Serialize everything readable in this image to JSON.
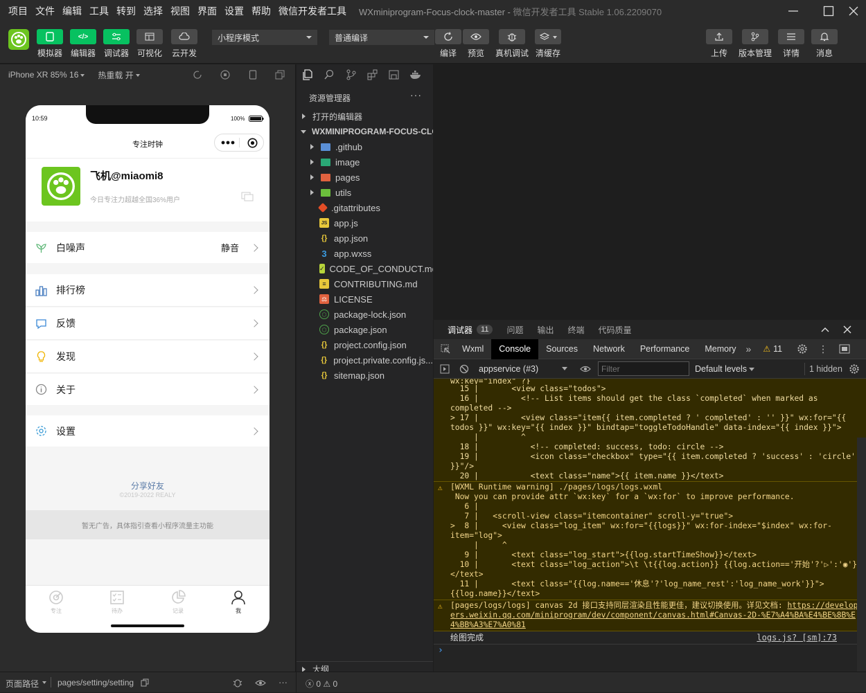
{
  "menu": {
    "items": [
      "项目",
      "文件",
      "编辑",
      "工具",
      "转到",
      "选择",
      "视图",
      "界面",
      "设置",
      "帮助",
      "微信开发者工具"
    ],
    "project_title": "WXminiprogram-Focus-clock-master",
    "app_version": "微信开发者工具 Stable 1.06.2209070"
  },
  "toolbar": {
    "simulator": "模拟器",
    "editor": "编辑器",
    "debugger": "调试器",
    "visual": "可视化",
    "cloud": "云开发",
    "mode_select": "小程序模式",
    "compile_select": "普通编译",
    "compile": "编译",
    "preview": "预览",
    "real_debug": "真机调试",
    "clear_cache": "清缓存",
    "upload": "上传",
    "version": "版本管理",
    "details": "详情",
    "messages": "消息",
    "accent": "#07c160"
  },
  "simulator": {
    "device": "iPhone XR 85% 16",
    "hot_reload": "热重载 开",
    "status_time": "10:59",
    "battery": "100%",
    "nav_title": "专注时钟",
    "user_name": "飞机@miaomi8",
    "user_sub": "今日专注力超越全国36%用户",
    "menu_items": [
      {
        "label": "白噪声",
        "value": "静音"
      },
      {
        "label": "排行榜",
        "value": ""
      },
      {
        "label": "反馈",
        "value": ""
      },
      {
        "label": "发现",
        "value": ""
      },
      {
        "label": "关于",
        "value": ""
      },
      {
        "label": "设置",
        "value": ""
      }
    ],
    "share": "分享好友",
    "copyright": "©2019-2022 REALY",
    "ad_text": "暂无广告，具体指引查看小程序流量主功能",
    "tabbar": [
      "专注",
      "待办",
      "记录",
      "我"
    ]
  },
  "explorer": {
    "title": "资源管理器",
    "open_editors": "打开的编辑器",
    "project_root": "WXMINIPROGRAM-FOCUS-CLO...",
    "folders": [
      ".github",
      "image",
      "pages",
      "utils"
    ],
    "files": [
      ".gitattributes",
      "app.js",
      "app.json",
      "app.wxss",
      "CODE_OF_CONDUCT.md",
      "CONTRIBUTING.md",
      "LICENSE",
      "package-lock.json",
      "package.json",
      "project.config.json",
      "project.private.config.js...",
      "sitemap.json"
    ],
    "outline": "大纲"
  },
  "devtools": {
    "panels": [
      "调试器",
      "问题",
      "输出",
      "终端",
      "代码质量"
    ],
    "debugger_badge": "11",
    "tabs": [
      "Wxml",
      "Console",
      "Sources",
      "Network",
      "Performance",
      "Memory"
    ],
    "active_tab": "Console",
    "warn_count": "11",
    "context": "appservice (#3)",
    "filter_placeholder": "Filter",
    "levels": "Default levels",
    "hidden": "1 hidden",
    "console_lines": {
      "l0": "wx:key=\"index\" ?}",
      "l1": "  15 |       <view class=\"todos\">",
      "l2": "  16 |         <!-- List items should get the class `completed` when marked as completed -->",
      "l3": "> 17 |         <view class=\"item{{ item.completed ? ' completed' : '' }}\" wx:for=\"{{ todos }}\" wx:key=\"{{ index }}\" bindtap=\"toggleTodoHandle\" data-index=\"{{ index }}\">",
      "l4": "     |         ^",
      "l5": "  18 |           <!-- completed: success, todo: circle -->",
      "l6": "  19 |           <icon class=\"checkbox\" type=\"{{ item.completed ? 'success' : 'circle' }}\"/>",
      "l7": "  20 |           <text class=\"name\">{{ item.name }}</text>",
      "w1": "[WXML Runtime warning] ./pages/logs/logs.wxml\n Now you can provide attr `wx:key` for a `wx:for` to improve performance.\n   6 |\n   7 |   <scroll-view class=\"itemcontainer\" scroll-y=\"true\">\n>  8 |     <view class=\"log_item\" wx:for=\"{{logs}}\" wx:for-index=\"$index\" wx:for-item=\"log\">\n     |     ^\n   9 |       <text class=\"log_start\">{{log.startTimeShow}}</text>\n  10 |       <text class=\"log_action\">\\t \\t{{log.action}} {{log.action=='开始'?'▷':'◉'}} </text>\n  11 |       <text class=\"{{log.name=='休息'?'log_name_rest':'log_name_work'}}\">{{log.name}}</text>",
      "w2_prefix": "[pages/logs/logs] canvas 2d 接口支持同层渲染且性能更佳，建议切换使用。详见文档: ",
      "w2_link": "https://developers.weixin.qq.com/miniprogram/dev/component/canvas.html#Canvas-2D-%E7%A4%BA%E4%BE%8B%E4%BB%A3%E7%A0%81",
      "info": "绘图完成",
      "info_src": "logs.js? [sm]:73"
    }
  },
  "status": {
    "path_label": "页面路径",
    "path": "pages/setting/setting",
    "errors": "0",
    "warnings": "0"
  }
}
